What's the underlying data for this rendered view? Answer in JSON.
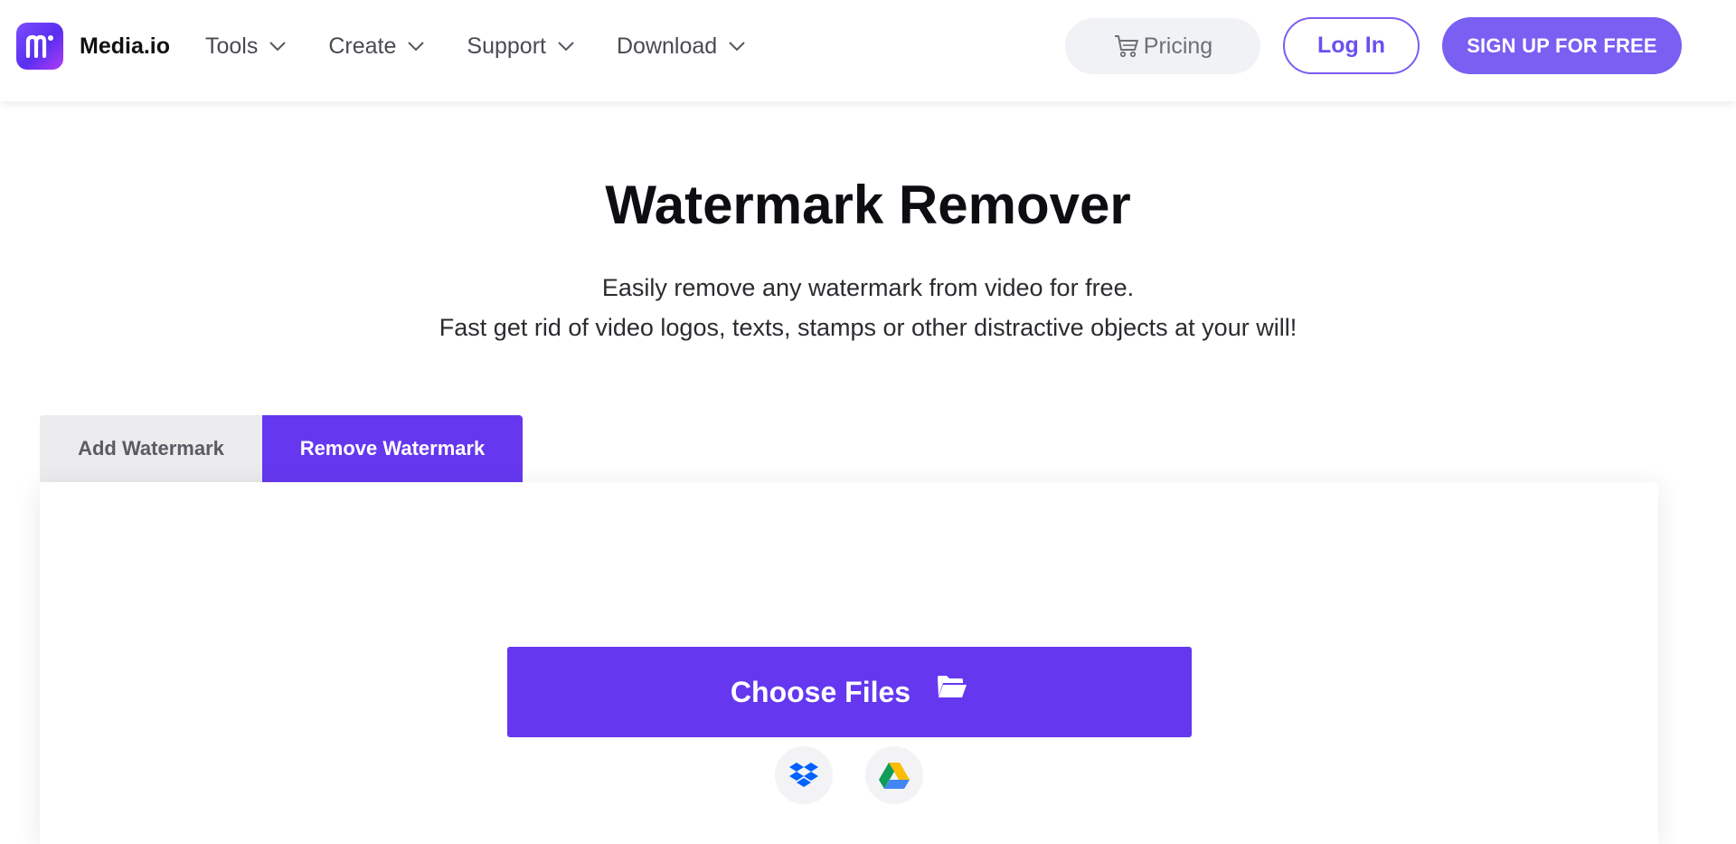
{
  "header": {
    "brand": "Media.io",
    "nav": [
      {
        "label": "Tools"
      },
      {
        "label": "Create"
      },
      {
        "label": "Support"
      },
      {
        "label": "Download"
      }
    ],
    "pricing_label": "Pricing",
    "login_label": "Log In",
    "signup_label": "SIGN UP FOR FREE"
  },
  "hero": {
    "title": "Watermark Remover",
    "subtitle_line1": "Easily remove any watermark from video for free.",
    "subtitle_line2": "Fast get rid of video logos, texts, stamps or other distractive objects at your will!"
  },
  "tabs": [
    {
      "label": "Add Watermark",
      "active": false
    },
    {
      "label": "Remove Watermark",
      "active": true
    }
  ],
  "upload": {
    "choose_label": "Choose Files",
    "sources": [
      {
        "icon": "dropbox-icon"
      },
      {
        "icon": "google-drive-icon"
      }
    ]
  },
  "colors": {
    "accent": "#6538ef",
    "signup_bg": "#7a5ff3",
    "login_border": "#7c5cf2"
  }
}
